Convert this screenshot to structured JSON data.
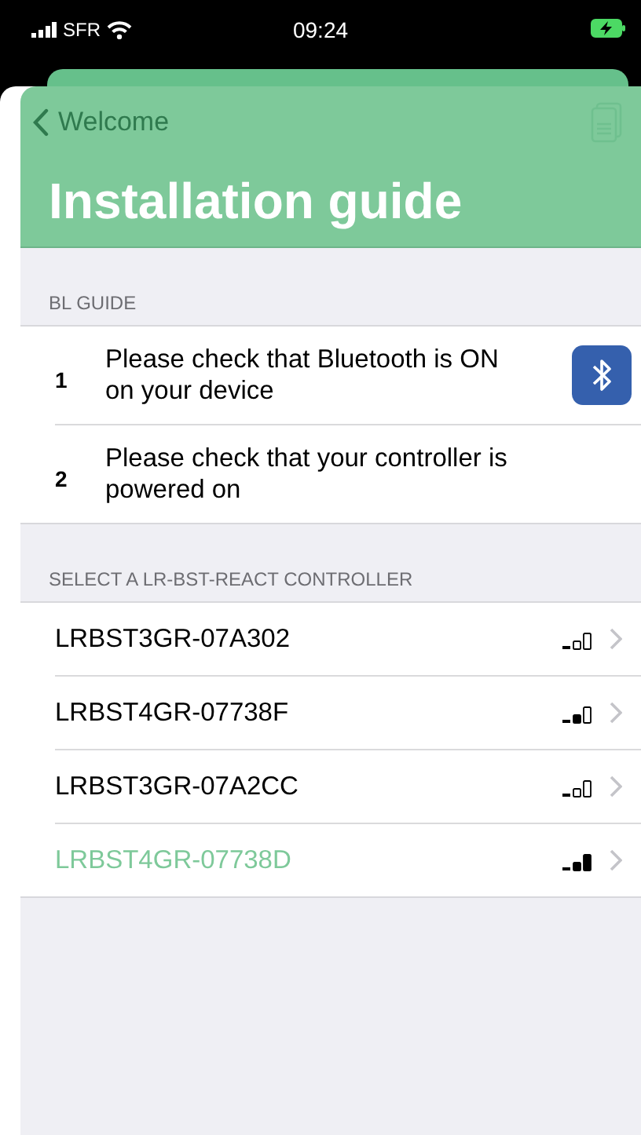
{
  "status_bar": {
    "carrier": "SFR",
    "time": "09:24"
  },
  "nav": {
    "back_label": "Welcome",
    "title": "Installation guide"
  },
  "guide": {
    "header": "BL GUIDE",
    "steps": [
      {
        "number": "1",
        "text": "Please check that Bluetooth is ON on your device",
        "kind": "bluetooth"
      },
      {
        "number": "2",
        "text": "Please check that your controller is powered on",
        "kind": "plain"
      }
    ]
  },
  "controllers": {
    "header": "SELECT A LR-BST-REACT CONTROLLER",
    "items": [
      {
        "name": "LRBST3GR-07A302",
        "kind": "weak",
        "selected": false
      },
      {
        "name": "LRBST4GR-07738F",
        "kind": "fair",
        "selected": false
      },
      {
        "name": "LRBST3GR-07A2CC",
        "kind": "weak",
        "selected": false
      },
      {
        "name": "LRBST4GR-07738D",
        "kind": "good",
        "selected": true
      }
    ]
  }
}
